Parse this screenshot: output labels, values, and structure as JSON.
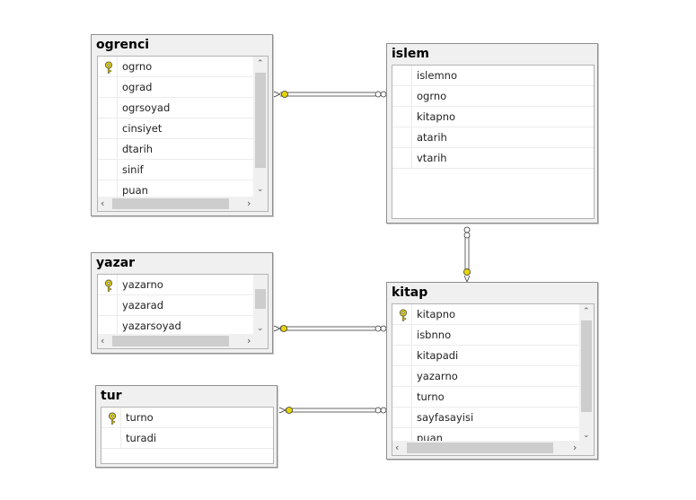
{
  "tables": {
    "ogrenci": {
      "title": "ogrenci",
      "columns": [
        "ogrno",
        "ograd",
        "ogrsoyad",
        "cinsiyet",
        "dtarih",
        "sinif",
        "puan"
      ]
    },
    "islem": {
      "title": "islem",
      "columns": [
        "islemno",
        "ogrno",
        "kitapno",
        "atarih",
        "vtarih"
      ]
    },
    "yazar": {
      "title": "yazar",
      "columns": [
        "yazarno",
        "yazarad",
        "yazarsoyad"
      ]
    },
    "kitap": {
      "title": "kitap",
      "columns": [
        "kitapno",
        "isbnno",
        "kitapadi",
        "yazarno",
        "turno",
        "sayfasayisi",
        "puan"
      ]
    },
    "tur": {
      "title": "tur",
      "columns": [
        "turno",
        "turadi"
      ]
    }
  },
  "icons": {
    "primary_key": "key-icon",
    "one_end": "key-icon",
    "many_end": "infinity-icon"
  },
  "colors": {
    "key_yellow": "#e8d400",
    "relation_line": "#666666",
    "table_header": "#f0f0f0"
  }
}
